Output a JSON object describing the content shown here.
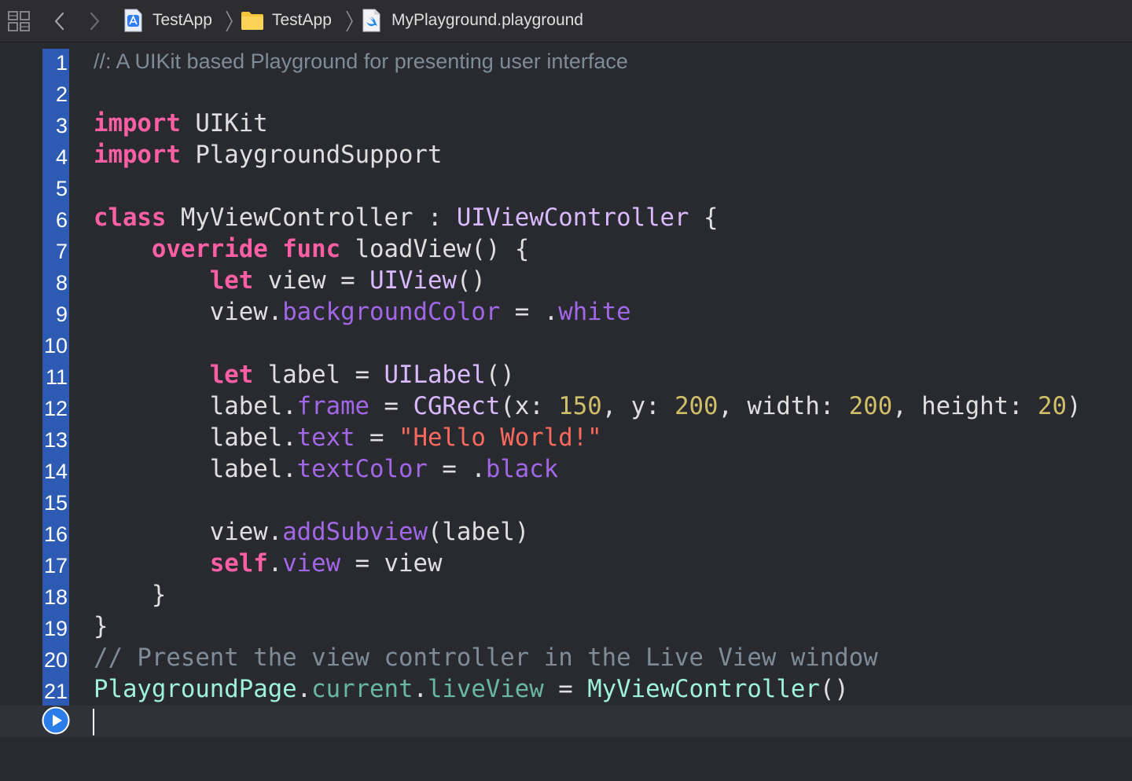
{
  "jump_bar": {
    "icons": [
      "grid-icon",
      "chevron-left-icon",
      "chevron-right-icon",
      "xcode-project-icon",
      "folder-icon",
      "swift-file-icon",
      "breadcrumb-chevron-icon"
    ],
    "breadcrumbs": [
      {
        "label": "TestApp",
        "icon": "xcode-project-icon"
      },
      {
        "label": "TestApp",
        "icon": "folder-icon"
      },
      {
        "label": "MyPlayground.playground",
        "icon": "swift-file-icon"
      }
    ]
  },
  "editor": {
    "line_numbers": [
      "1",
      "2",
      "3",
      "4",
      "5",
      "6",
      "7",
      "8",
      "9",
      "10",
      "11",
      "12",
      "13",
      "14",
      "15",
      "16",
      "17",
      "18",
      "19",
      "20",
      "21"
    ],
    "lines": [
      [
        [
          "docc",
          "//: A UIKit based Playground for presenting user interface"
        ]
      ],
      [],
      [
        [
          "kw",
          "import"
        ],
        [
          "plain",
          " UIKit"
        ]
      ],
      [
        [
          "kw",
          "import"
        ],
        [
          "plain",
          " PlaygroundSupport"
        ]
      ],
      [],
      [
        [
          "kw",
          "class"
        ],
        [
          "plain",
          " MyViewController : "
        ],
        [
          "typ",
          "UIViewController"
        ],
        [
          "plain",
          " {"
        ]
      ],
      [
        [
          "plain",
          "    "
        ],
        [
          "kw",
          "override"
        ],
        [
          "plain",
          " "
        ],
        [
          "kw",
          "func"
        ],
        [
          "plain",
          " loadView() {"
        ]
      ],
      [
        [
          "plain",
          "        "
        ],
        [
          "kw",
          "let"
        ],
        [
          "plain",
          " view = "
        ],
        [
          "typ",
          "UIView"
        ],
        [
          "plain",
          "()"
        ]
      ],
      [
        [
          "plain",
          "        view."
        ],
        [
          "prop",
          "backgroundColor"
        ],
        [
          "plain",
          " = ."
        ],
        [
          "prop",
          "white"
        ]
      ],
      [],
      [
        [
          "plain",
          "        "
        ],
        [
          "kw",
          "let"
        ],
        [
          "plain",
          " label = "
        ],
        [
          "typ",
          "UILabel"
        ],
        [
          "plain",
          "()"
        ]
      ],
      [
        [
          "plain",
          "        label."
        ],
        [
          "prop",
          "frame"
        ],
        [
          "plain",
          " = "
        ],
        [
          "typ",
          "CGRect"
        ],
        [
          "plain",
          "(x: "
        ],
        [
          "num",
          "150"
        ],
        [
          "plain",
          ", y: "
        ],
        [
          "num",
          "200"
        ],
        [
          "plain",
          ", width: "
        ],
        [
          "num",
          "200"
        ],
        [
          "plain",
          ", height: "
        ],
        [
          "num",
          "20"
        ],
        [
          "plain",
          ")"
        ]
      ],
      [
        [
          "plain",
          "        label."
        ],
        [
          "prop",
          "text"
        ],
        [
          "plain",
          " = "
        ],
        [
          "str",
          "\"Hello World!\""
        ]
      ],
      [
        [
          "plain",
          "        label."
        ],
        [
          "prop",
          "textColor"
        ],
        [
          "plain",
          " = ."
        ],
        [
          "prop",
          "black"
        ]
      ],
      [],
      [
        [
          "plain",
          "        view."
        ],
        [
          "prop",
          "addSubview"
        ],
        [
          "plain",
          "(label)"
        ]
      ],
      [
        [
          "plain",
          "        "
        ],
        [
          "kw",
          "self"
        ],
        [
          "plain",
          "."
        ],
        [
          "prop",
          "view"
        ],
        [
          "plain",
          " = view"
        ]
      ],
      [
        [
          "plain",
          "    }"
        ]
      ],
      [
        [
          "plain",
          "}"
        ]
      ],
      [
        [
          "cmt",
          "// Present the view controller in the Live View window"
        ]
      ],
      [
        [
          "cls",
          "PlaygroundPage"
        ],
        [
          "plain",
          "."
        ],
        [
          "prj",
          "current"
        ],
        [
          "plain",
          "."
        ],
        [
          "prj",
          "liveView"
        ],
        [
          "plain",
          " = "
        ],
        [
          "cls",
          "MyViewController"
        ],
        [
          "plain",
          "()"
        ]
      ]
    ],
    "run_icon": "play-circle-icon"
  },
  "colors": {
    "background": "#292a30",
    "gutter_selection": "#2d5bb3",
    "keyword": "#fc5fa3",
    "type": "#dabaff",
    "property": "#a167e6",
    "project_class": "#9ef1dd",
    "project_member": "#67b7a4",
    "number": "#d0bf69",
    "string": "#fc6a5d",
    "comment": "#7f8c98",
    "plain": "#dfdfe0"
  }
}
